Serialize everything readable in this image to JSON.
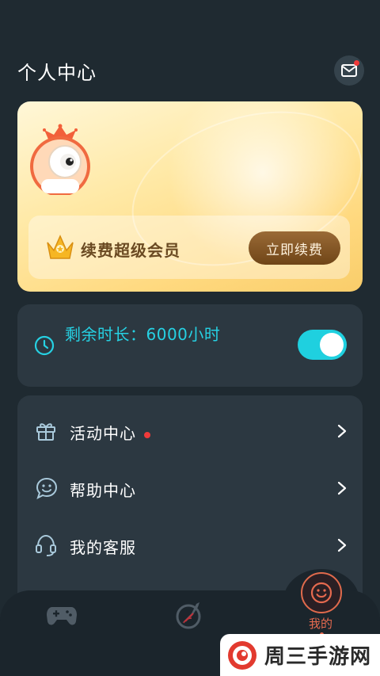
{
  "header": {
    "title": "个人中心",
    "mail_icon": "mail-icon",
    "has_unread": true
  },
  "vip_card": {
    "renew_title": "续费超级会员",
    "renew_button": "立即续费"
  },
  "time_card": {
    "remaining_text": "剩余时长：6000小时",
    "toggle_on": true
  },
  "menu": {
    "items": [
      {
        "label": "活动中心",
        "icon": "gift-icon",
        "has_dot": true
      },
      {
        "label": "帮助中心",
        "icon": "smile-chat-icon",
        "has_dot": false
      },
      {
        "label": "我的客服",
        "icon": "headset-icon",
        "has_dot": false
      }
    ]
  },
  "bottom_nav": {
    "mine_label": "我的",
    "active": "mine"
  },
  "watermark": {
    "text": "周三手游网"
  },
  "colors": {
    "background": "#1f2a31",
    "card": "#2c3841",
    "accent_cyan": "#26d1e3",
    "accent_orange": "#e66a4f",
    "badge_red": "#f03a3a",
    "vip_gold": "#ffd97f"
  }
}
